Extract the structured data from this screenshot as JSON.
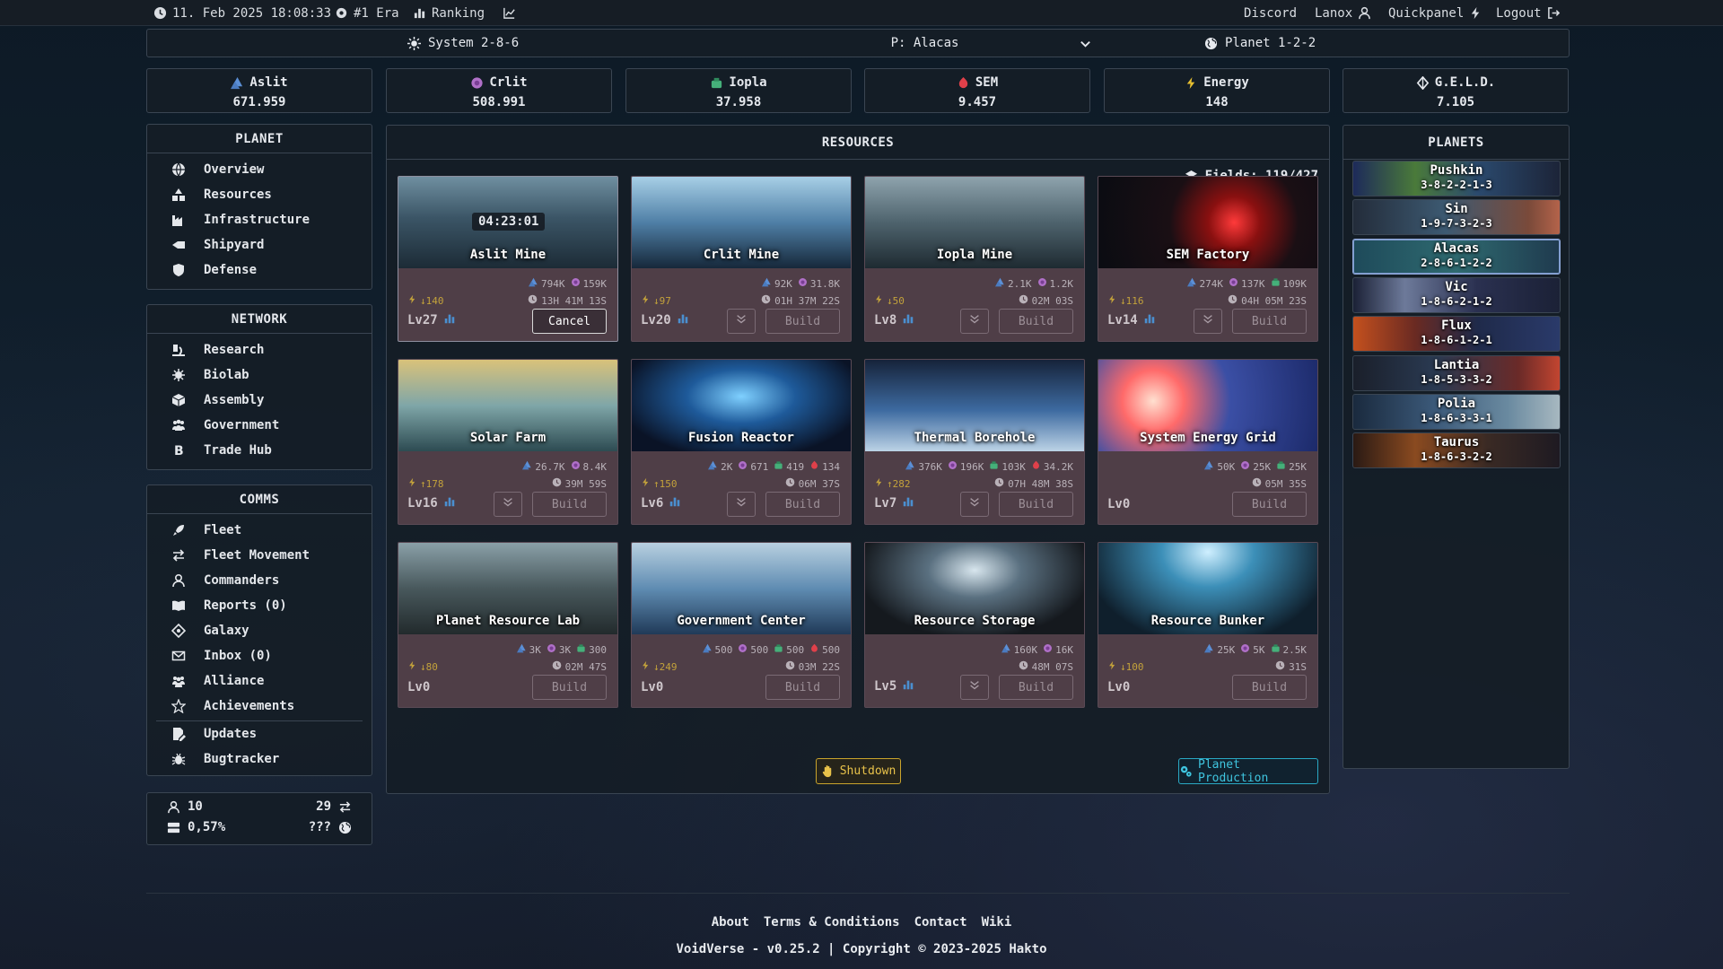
{
  "topbar": {
    "datetime": "11. Feb 2025 18:08:33",
    "era": "#1 Era",
    "ranking": "Ranking",
    "discord": "Discord",
    "user": "Lanox",
    "quickpanel": "Quickpanel",
    "logout": "Logout"
  },
  "system_bar": {
    "system": "System 2-8-6",
    "planet_select": "P: Alacas",
    "planet": "Planet 1-2-2"
  },
  "resources_bar": [
    {
      "name": "Aslit",
      "value": "671.959",
      "color": "#5b8fd6",
      "icon": "aslit-icon"
    },
    {
      "name": "Crlit",
      "value": "508.991",
      "color": "#b070c8",
      "icon": "crlit-icon"
    },
    {
      "name": "Iopla",
      "value": "37.958",
      "color": "#45b07a",
      "icon": "iopla-icon"
    },
    {
      "name": "SEM",
      "value": "9.457",
      "color": "#e0404a",
      "icon": "sem-icon"
    },
    {
      "name": "Energy",
      "value": "148",
      "color": "#e8c030",
      "icon": "energy-icon"
    },
    {
      "name": "G.E.L.D.",
      "value": "7.105",
      "color": "#e6e9ee",
      "icon": "geld-icon"
    }
  ],
  "sidebar": {
    "planet": {
      "title": "PLANET",
      "items": [
        "Overview",
        "Resources",
        "Infrastructure",
        "Shipyard",
        "Defense"
      ]
    },
    "network": {
      "title": "NETWORK",
      "items": [
        "Research",
        "Biolab",
        "Assembly",
        "Government",
        "Trade Hub"
      ]
    },
    "comms": {
      "title": "COMMS",
      "items": [
        "Fleet",
        "Fleet Movement",
        "Commanders",
        "Reports (0)",
        "Galaxy",
        "Inbox (0)",
        "Alliance",
        "Achievements",
        "Updates",
        "Bugtracker"
      ]
    }
  },
  "stats": {
    "players": "10",
    "trades": "29",
    "percent": "0,57%",
    "unknown": "???"
  },
  "main": {
    "title": "RESOURCES",
    "fields": "Fields: 119/427",
    "shutdown": "Shutdown",
    "planet_production": "Planet Production",
    "buildings": [
      {
        "name": "Aslit Mine",
        "costs": [
          "794K",
          "159K"
        ],
        "energy": "↓140",
        "time": "13H 41M 13S",
        "level": "Lv27",
        "button": "Cancel",
        "timer": "04:23:01",
        "active": true
      },
      {
        "name": "Crlit Mine",
        "costs": [
          "92K",
          "31.8K"
        ],
        "energy": "↓97",
        "time": "01H 37M 22S",
        "level": "Lv20",
        "button": "Build",
        "active": false
      },
      {
        "name": "Iopla Mine",
        "costs": [
          "2.1K",
          "1.2K"
        ],
        "energy": "↓50",
        "time": "02M 03S",
        "level": "Lv8",
        "button": "Build",
        "active": false
      },
      {
        "name": "SEM Factory",
        "costs": [
          "274K",
          "137K",
          "109K"
        ],
        "energy": "↓116",
        "time": "04H 05M 23S",
        "level": "Lv14",
        "button": "Build",
        "active": false
      },
      {
        "name": "Solar Farm",
        "costs": [
          "26.7K",
          "8.4K"
        ],
        "energy": "↑178",
        "time": "39M 59S",
        "level": "Lv16",
        "button": "Build",
        "active": false
      },
      {
        "name": "Fusion Reactor",
        "costs": [
          "2K",
          "671",
          "419",
          "134"
        ],
        "energy": "↑150",
        "time": "06M 37S",
        "level": "Lv6",
        "button": "Build",
        "active": false
      },
      {
        "name": "Thermal Borehole",
        "costs": [
          "376K",
          "196K",
          "103K",
          "34.2K"
        ],
        "energy": "↑282",
        "time": "07H 48M 38S",
        "level": "Lv7",
        "button": "Build",
        "active": false
      },
      {
        "name": "System Energy Grid",
        "costs": [
          "50K",
          "25K",
          "25K"
        ],
        "energy": "",
        "time": "05M 35S",
        "level": "Lv0",
        "button": "Build",
        "active": false
      },
      {
        "name": "Planet Resource Lab",
        "costs": [
          "3K",
          "3K",
          "300"
        ],
        "energy": "↓80",
        "time": "02M 47S",
        "level": "Lv0",
        "button": "Build",
        "active": false
      },
      {
        "name": "Government Center",
        "costs": [
          "500",
          "500",
          "500",
          "500"
        ],
        "energy": "↓249",
        "time": "03M 22S",
        "level": "Lv0",
        "button": "Build",
        "active": false
      },
      {
        "name": "Resource Storage",
        "costs": [
          "160K",
          "16K"
        ],
        "energy": "",
        "time": "48M 07S",
        "level": "Lv5",
        "button": "Build",
        "active": false
      },
      {
        "name": "Resource Bunker",
        "costs": [
          "25K",
          "5K",
          "2.5K"
        ],
        "energy": "↓100",
        "time": "31S",
        "level": "Lv0",
        "button": "Build",
        "active": false
      }
    ]
  },
  "planets": {
    "title": "PLANETS",
    "list": [
      {
        "name": "Pushkin",
        "coords": "3-8-2-2-1-3"
      },
      {
        "name": "Sin",
        "coords": "1-9-7-3-2-3"
      },
      {
        "name": "Alacas",
        "coords": "2-8-6-1-2-2"
      },
      {
        "name": "Vic",
        "coords": "1-8-6-2-1-2"
      },
      {
        "name": "Flux",
        "coords": "1-8-6-1-2-1"
      },
      {
        "name": "Lantia",
        "coords": "1-8-5-3-3-2"
      },
      {
        "name": "Polia",
        "coords": "1-8-6-3-3-1"
      },
      {
        "name": "Taurus",
        "coords": "1-8-6-3-2-2"
      }
    ]
  },
  "footer": {
    "links": [
      "About",
      "Terms & Conditions",
      "Contact",
      "Wiki"
    ],
    "copyright": "VoidVerse - v0.25.2 | Copyright © 2023-2025 Hakto"
  }
}
